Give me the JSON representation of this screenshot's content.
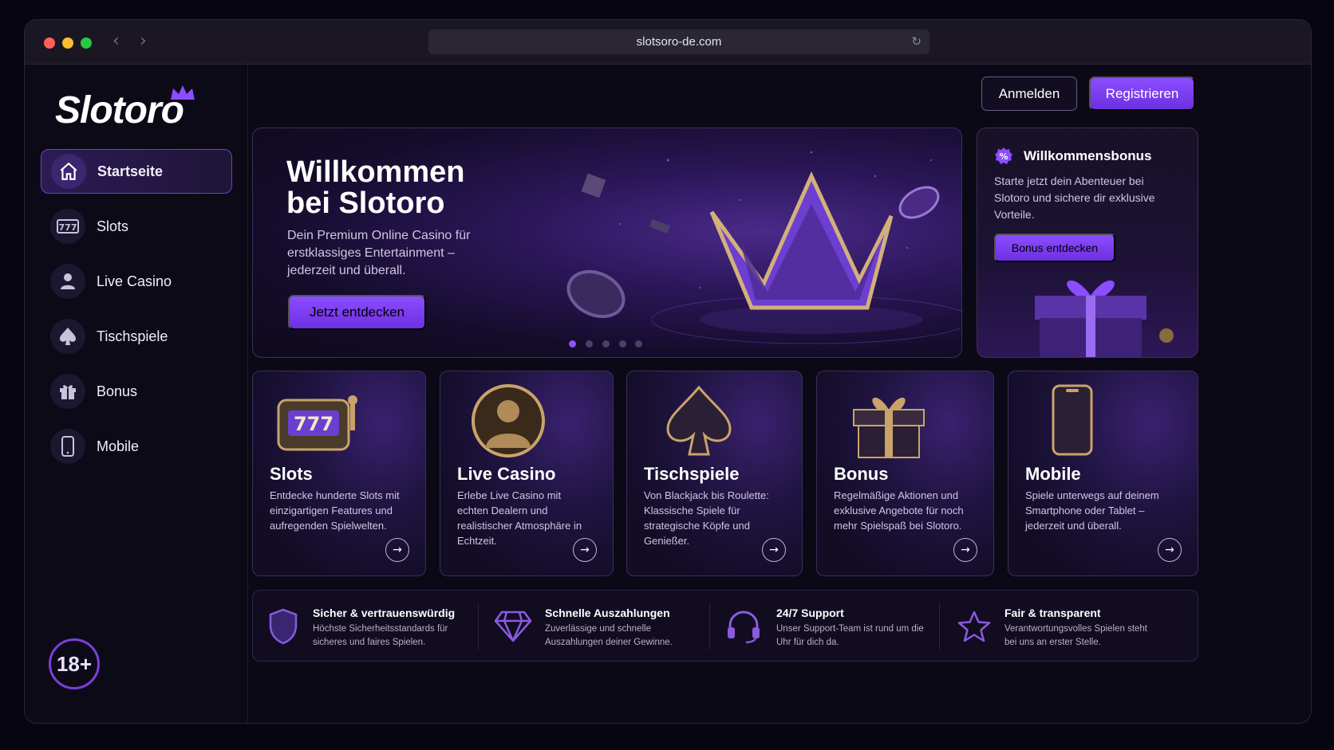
{
  "browser": {
    "url": "slotsoro-de.com"
  },
  "brand": {
    "name": "Slotoro",
    "accent": "#7b3fd9"
  },
  "sidebar": {
    "items": [
      {
        "label": "Startseite",
        "icon": "home-icon",
        "active": true
      },
      {
        "label": "Slots",
        "icon": "slot-777-icon"
      },
      {
        "label": "Live Casino",
        "icon": "dealer-icon"
      },
      {
        "label": "Tischspiele",
        "icon": "spade-icon"
      },
      {
        "label": "Bonus",
        "icon": "gift-icon"
      },
      {
        "label": "Mobile",
        "icon": "phone-icon"
      }
    ],
    "age_badge": "18+"
  },
  "header": {
    "login_label": "Anmelden",
    "register_label": "Registrieren"
  },
  "hero": {
    "title_line1": "Willkommen",
    "title_line2": "bei Slotoro",
    "text": "Dein Premium Online Casino für erstklassiges Entertainment – jederzeit und überall.",
    "cta_label": "Jetzt entdecken",
    "slides": 5,
    "active_slide": 1
  },
  "bonus_panel": {
    "title": "Willkommensbonus",
    "text": "Starte jetzt dein Abenteuer bei Slotoro und sichere dir exklusive Vorteile.",
    "cta_label": "Bonus entdecken"
  },
  "cards": [
    {
      "title": "Slots",
      "text": "Entdecke hunderte Slots mit einzigartigen Features und aufregenden Spielwelten.",
      "icon": "slot-machine-icon"
    },
    {
      "title": "Live Casino",
      "text": "Erlebe Live Casino mit echten Dealern und realistischer Atmosphäre in Echtzeit.",
      "icon": "dealer-icon"
    },
    {
      "title": "Tischspiele",
      "text": "Von Blackjack bis Roulette: Klassische Spiele für strategische Köpfe und Genießer.",
      "icon": "spade-icon"
    },
    {
      "title": "Bonus",
      "text": "Regelmäßige Aktionen und exklusive Angebote für noch mehr Spielspaß bei Slotoro.",
      "icon": "gift-icon"
    },
    {
      "title": "Mobile",
      "text": "Spiele unterwegs auf deinem Smartphone oder Tablet – jederzeit und überall.",
      "icon": "phone-icon"
    }
  ],
  "features": [
    {
      "title": "Sicher & vertrauenswürdig",
      "text": "Höchste Sicherheitsstandards für sicheres und faires Spielen.",
      "icon": "shield-icon"
    },
    {
      "title": "Schnelle Auszahlungen",
      "text": "Zuverlässige und schnelle Auszahlungen deiner Gewinne.",
      "icon": "diamond-icon"
    },
    {
      "title": "24/7 Support",
      "text": "Unser Support-Team ist rund um die Uhr für dich da.",
      "icon": "headset-icon"
    },
    {
      "title": "Fair & transparent",
      "text": "Verantwortungsvolles Spielen steht bei uns an erster Stelle.",
      "icon": "star-icon"
    }
  ]
}
